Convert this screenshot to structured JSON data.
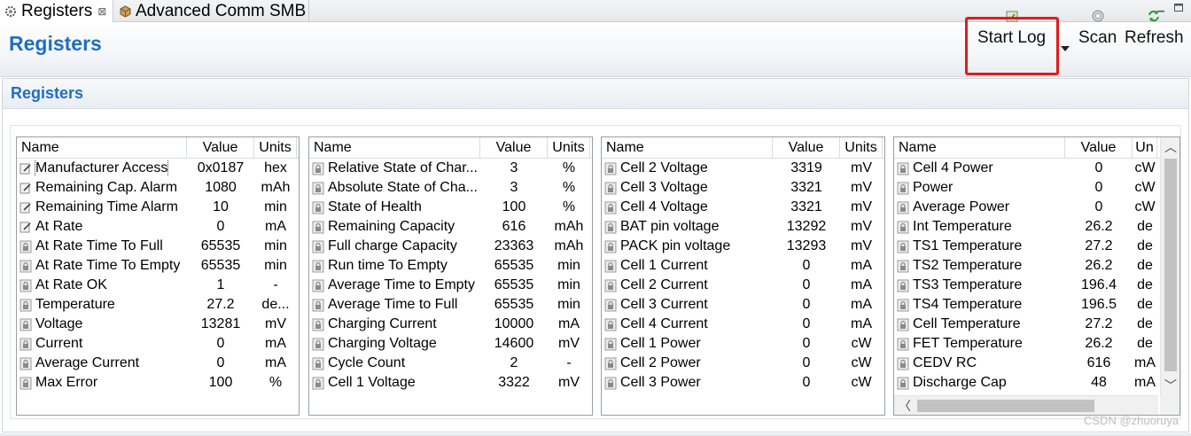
{
  "tabs": [
    {
      "label": "Registers",
      "icon": "gear-icon",
      "active": true,
      "close": "⊠"
    },
    {
      "label": "Advanced Comm SMB",
      "icon": "package-icon",
      "active": false
    }
  ],
  "header": {
    "title": "Registers"
  },
  "toolbar": {
    "start_log_label": "Start Log",
    "scan_label": "Scan",
    "refresh_label": "Refresh"
  },
  "section": {
    "title": "Registers"
  },
  "tables": [
    {
      "headers": {
        "name": "Name",
        "value": "Value",
        "units": "Units"
      },
      "rows": [
        {
          "name": "Manufacturer Access",
          "value": "0x0187",
          "units": "hex",
          "icon": "edit-icon"
        },
        {
          "name": "Remaining Cap. Alarm",
          "value": "1080",
          "units": "mAh",
          "icon": "edit-icon"
        },
        {
          "name": "Remaining Time Alarm",
          "value": "10",
          "units": "min",
          "icon": "edit-icon"
        },
        {
          "name": "At Rate",
          "value": "0",
          "units": "mA",
          "icon": "edit-icon"
        },
        {
          "name": "At Rate Time To Full",
          "value": "65535",
          "units": "min",
          "icon": "lock-icon"
        },
        {
          "name": "At Rate Time To Empty",
          "value": "65535",
          "units": "min",
          "icon": "lock-icon"
        },
        {
          "name": "At Rate OK",
          "value": "1",
          "units": "-",
          "icon": "lock-icon"
        },
        {
          "name": "Temperature",
          "value": "27.2",
          "units": "de...",
          "icon": "lock-icon"
        },
        {
          "name": "Voltage",
          "value": "13281",
          "units": "mV",
          "icon": "lock-icon"
        },
        {
          "name": "Current",
          "value": "0",
          "units": "mA",
          "icon": "lock-icon"
        },
        {
          "name": "Average Current",
          "value": "0",
          "units": "mA",
          "icon": "lock-icon"
        },
        {
          "name": "Max Error",
          "value": "100",
          "units": "%",
          "icon": "lock-icon"
        }
      ]
    },
    {
      "headers": {
        "name": "Name",
        "value": "Value",
        "units": "Units"
      },
      "rows": [
        {
          "name": "Relative State of Char...",
          "value": "3",
          "units": "%",
          "icon": "lock-icon"
        },
        {
          "name": "Absolute State of Cha...",
          "value": "3",
          "units": "%",
          "icon": "lock-icon"
        },
        {
          "name": "State of Health",
          "value": "100",
          "units": "%",
          "icon": "lock-icon"
        },
        {
          "name": "Remaining Capacity",
          "value": "616",
          "units": "mAh",
          "icon": "lock-icon"
        },
        {
          "name": "Full charge Capacity",
          "value": "23363",
          "units": "mAh",
          "icon": "lock-icon"
        },
        {
          "name": "Run time To Empty",
          "value": "65535",
          "units": "min",
          "icon": "lock-icon"
        },
        {
          "name": "Average Time to Empty",
          "value": "65535",
          "units": "min",
          "icon": "lock-icon"
        },
        {
          "name": "Average Time to Full",
          "value": "65535",
          "units": "min",
          "icon": "lock-icon"
        },
        {
          "name": "Charging Current",
          "value": "10000",
          "units": "mA",
          "icon": "lock-icon"
        },
        {
          "name": "Charging Voltage",
          "value": "14600",
          "units": "mV",
          "icon": "lock-icon"
        },
        {
          "name": "Cycle Count",
          "value": "2",
          "units": "-",
          "icon": "lock-icon"
        },
        {
          "name": "Cell 1 Voltage",
          "value": "3322",
          "units": "mV",
          "icon": "lock-icon"
        }
      ]
    },
    {
      "headers": {
        "name": "Name",
        "value": "Value",
        "units": "Units"
      },
      "rows": [
        {
          "name": "Cell 2 Voltage",
          "value": "3319",
          "units": "mV",
          "icon": "lock-icon"
        },
        {
          "name": "Cell 3 Voltage",
          "value": "3321",
          "units": "mV",
          "icon": "lock-icon"
        },
        {
          "name": "Cell 4 Voltage",
          "value": "3321",
          "units": "mV",
          "icon": "lock-icon"
        },
        {
          "name": "BAT pin voltage",
          "value": "13292",
          "units": "mV",
          "icon": "lock-icon"
        },
        {
          "name": "PACK pin voltage",
          "value": "13293",
          "units": "mV",
          "icon": "lock-icon"
        },
        {
          "name": "Cell 1 Current",
          "value": "0",
          "units": "mA",
          "icon": "lock-icon"
        },
        {
          "name": "Cell 2 Current",
          "value": "0",
          "units": "mA",
          "icon": "lock-icon"
        },
        {
          "name": "Cell 3 Current",
          "value": "0",
          "units": "mA",
          "icon": "lock-icon"
        },
        {
          "name": "Cell 4 Current",
          "value": "0",
          "units": "mA",
          "icon": "lock-icon"
        },
        {
          "name": "Cell 1 Power",
          "value": "0",
          "units": "cW",
          "icon": "lock-icon"
        },
        {
          "name": "Cell 2 Power",
          "value": "0",
          "units": "cW",
          "icon": "lock-icon"
        },
        {
          "name": "Cell 3 Power",
          "value": "0",
          "units": "cW",
          "icon": "lock-icon"
        }
      ]
    },
    {
      "headers": {
        "name": "Name",
        "value": "Value",
        "units": "Un"
      },
      "rows": [
        {
          "name": "Cell 4 Power",
          "value": "0",
          "units": "cW",
          "icon": "lock-icon"
        },
        {
          "name": "Power",
          "value": "0",
          "units": "cW",
          "icon": "lock-icon"
        },
        {
          "name": "Average Power",
          "value": "0",
          "units": "cW",
          "icon": "lock-icon"
        },
        {
          "name": "Int Temperature",
          "value": "26.2",
          "units": "de",
          "icon": "lock-icon"
        },
        {
          "name": "TS1 Temperature",
          "value": "27.2",
          "units": "de",
          "icon": "lock-icon"
        },
        {
          "name": "TS2 Temperature",
          "value": "26.2",
          "units": "de",
          "icon": "lock-icon"
        },
        {
          "name": "TS3 Temperature",
          "value": "196.4",
          "units": "de",
          "icon": "lock-icon"
        },
        {
          "name": "TS4 Temperature",
          "value": "196.5",
          "units": "de",
          "icon": "lock-icon"
        },
        {
          "name": "Cell Temperature",
          "value": "27.2",
          "units": "de",
          "icon": "lock-icon"
        },
        {
          "name": "FET Temperature",
          "value": "26.2",
          "units": "de",
          "icon": "lock-icon"
        },
        {
          "name": "CEDV RC",
          "value": "616",
          "units": "mA",
          "icon": "lock-icon"
        },
        {
          "name": "Discharge Cap",
          "value": "48",
          "units": "mA",
          "icon": "lock-icon"
        }
      ]
    }
  ],
  "watermark": "CSDN @zhuoruya",
  "colors": {
    "accent": "#1c6fc4",
    "highlight": "#e21b1b"
  }
}
